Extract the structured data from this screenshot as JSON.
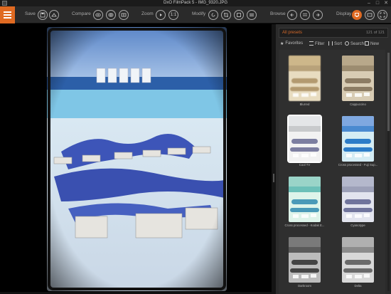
{
  "window": {
    "title": "DxO FilmPack 5 - IMG_9320.JPG",
    "minimize": "–",
    "maximize": "□",
    "close": "✕"
  },
  "toolbar": {
    "save_label": "Save",
    "compare_label": "Compare",
    "zoom_label": "Zoom",
    "zoom_one": "1:1",
    "modify_label": "Modify",
    "browse_label": "Browse",
    "display_label": "Display"
  },
  "panel": {
    "preset_filter": "All presets",
    "count": "121 of 121",
    "tools": {
      "favorites": "Favorites",
      "filter": "Filter",
      "sort": "Sort",
      "search": "Search",
      "new": "New"
    },
    "presets": [
      {
        "name": "Blurred",
        "style": "blurred"
      },
      {
        "name": "Cappuccino",
        "style": "cappuccino"
      },
      {
        "name": "Cool TV",
        "style": "cooltv"
      },
      {
        "name": "Cross processed - Fuji Sup...",
        "style": "crossfuji"
      },
      {
        "name": "Cross processed - Kodak E...",
        "style": "crosskodak"
      },
      {
        "name": "Cyanotype",
        "style": "cyanotype"
      },
      {
        "name": "Darkroom",
        "style": "darkroom"
      },
      {
        "name": "Delta",
        "style": "delta"
      }
    ]
  },
  "icons": {
    "menu": "hamburger-icon",
    "save": "save-icon",
    "compare_a": "eye-icon",
    "compare_b": "split-view-icon",
    "compare_c": "before-after-icon",
    "zoom_fit": "play-icon",
    "modify_a": "rotate-icon",
    "modify_b": "crop-icon",
    "modify_c": "frame-icon",
    "modify_d": "adjust-icon",
    "browse_prev": "arrow-left-icon",
    "browse_grid": "grid-icon",
    "browse_next": "arrow-right-icon",
    "display_a": "single-view-icon",
    "display_b": "compare-view-icon",
    "display_c": "fullscreen-icon"
  },
  "colors": {
    "accent": "#e06a22",
    "panel_bg": "#2b2b2b",
    "toolbar_bg": "#2a2a2a"
  }
}
